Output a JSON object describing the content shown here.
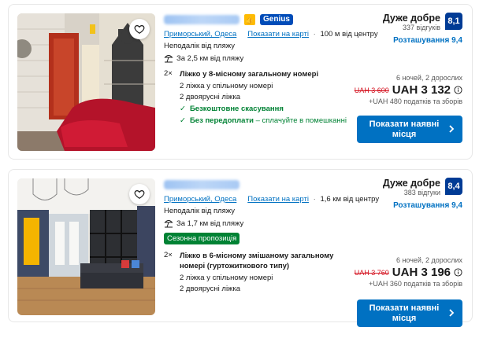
{
  "listings": [
    {
      "genius_label": "Genius",
      "thumb_icon": "thumbs-up-icon",
      "city_link": "Приморський, Одеса",
      "map_link": "Показати на карті",
      "distance_center": "100 м від центру",
      "near_beach": "Неподалік від пляжу",
      "beach_distance": "За 2,5 км від пляжу",
      "room_qty": "2×",
      "room_title": "Ліжко у 8-місному загальному номері",
      "room_line1": "2 ліжка у спільному номері",
      "room_line2": "2 двоярусні ліжка",
      "cond1": "Безкоштовне скасування",
      "cond2_bold": "Без передоплати",
      "cond2_rest": " – сплачуйте в помешканні",
      "score_word": "Дуже добре",
      "reviews": "337 відгуків",
      "score": "8,1",
      "location_score": "Розташування 9,4",
      "nights": "6 ночей, 2 дорослих",
      "old_price": "UAH 3 600",
      "new_price": "UAH 3 132",
      "tax": "+UAH 480 податків та зборів",
      "cta": "Показати наявні місця"
    },
    {
      "city_link": "Приморський, Одеса",
      "map_link": "Показати на карті",
      "distance_center": "1,6 км від центру",
      "near_beach": "Неподалік від пляжу",
      "beach_distance": "За 1,7 км від пляжу",
      "season_badge": "Сезонна пропозиція",
      "room_qty": "2×",
      "room_title": "Ліжко в 6-місному змішаному загальному номері (гуртожиткового типу)",
      "room_line1": "2 ліжка у спільному номері",
      "room_line2": "2 двоярусні ліжка",
      "score_word": "Дуже добре",
      "reviews": "383 відгуки",
      "score": "8,4",
      "location_score": "Розташування 9,4",
      "nights": "6 ночей, 2 дорослих",
      "old_price": "UAH 3 760",
      "new_price": "UAH 3 196",
      "tax": "+UAH 360 податків та зборів",
      "cta": "Показати наявні місця"
    }
  ],
  "colors": {
    "brand_blue": "#003b95",
    "link_blue": "#0071c2",
    "green": "#008234",
    "price_red": "#d4111e",
    "genius_yellow": "#febb02"
  }
}
